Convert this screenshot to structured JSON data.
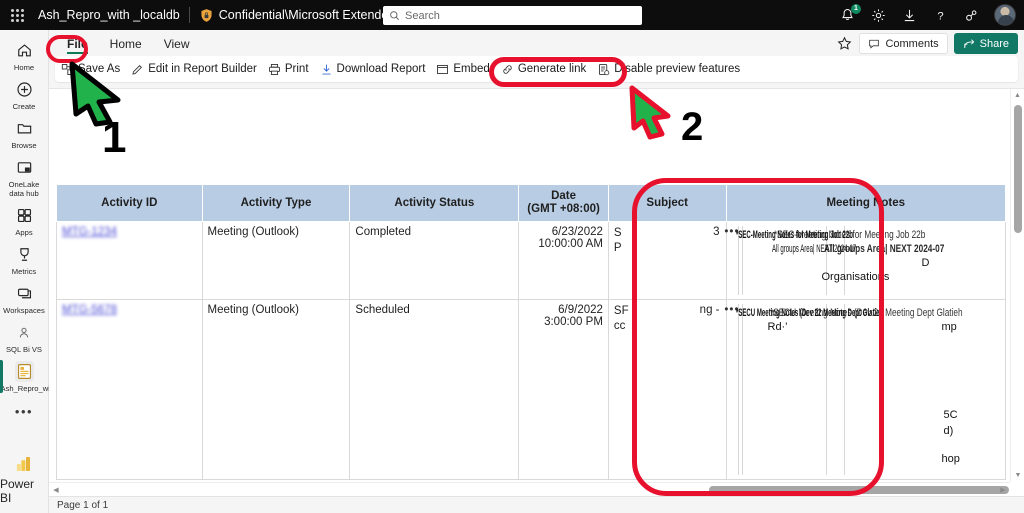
{
  "topbar": {
    "waffle_label": "app-launcher",
    "app_name": "Ash_Repro_with _localdb",
    "sensitivity_label": "Confidential\\Microsoft Extended",
    "sensitivity_chevron": "⌄",
    "search_placeholder": "Search",
    "notification_badge": "1",
    "icons": [
      "bell-icon",
      "gear-icon",
      "download-icon",
      "help-icon",
      "feedback-icon",
      "avatar"
    ]
  },
  "leftnav": {
    "items": [
      {
        "label": "Home",
        "icon": "home-icon"
      },
      {
        "label": "Create",
        "icon": "plus-circle-icon"
      },
      {
        "label": "Browse",
        "icon": "folder-icon"
      },
      {
        "label": "OneLake data hub",
        "icon": "datahub-icon"
      },
      {
        "label": "Apps",
        "icon": "apps-grid-icon"
      },
      {
        "label": "Metrics",
        "icon": "trophy-icon"
      },
      {
        "label": "Workspaces",
        "icon": "workspaces-icon"
      },
      {
        "label": "SQL Bi VS",
        "icon": "workspace-avatar-icon"
      },
      {
        "label": "Ash_Repro_with...",
        "icon": "report-icon"
      }
    ],
    "more": "•••",
    "footer_label": "Power BI"
  },
  "ribbon": {
    "tabs": [
      {
        "label": "File",
        "active": true
      },
      {
        "label": "Home",
        "active": false
      },
      {
        "label": "View",
        "active": false
      }
    ],
    "commands": [
      {
        "label": "Save As",
        "icon": "save-as-icon"
      },
      {
        "label": "Edit in Report Builder",
        "icon": "pencil-icon"
      },
      {
        "label": "Print",
        "icon": "printer-icon"
      },
      {
        "label": "Download Report",
        "icon": "download-arrow-icon"
      },
      {
        "label": "Embed",
        "icon": "embed-icon"
      },
      {
        "label": "Generate link",
        "icon": "link-icon"
      },
      {
        "label": "Disable preview features",
        "icon": "preview-features-icon"
      }
    ],
    "favorite_icon": "star-icon",
    "comments_label": "Comments",
    "share_label": "Share"
  },
  "report": {
    "columns": [
      "Activity ID",
      "Activity Type",
      "Activity Status",
      "Date\n(GMT +08:00)",
      "Subject",
      "Meeting Notes"
    ],
    "date_header_line1": "Date",
    "date_header_line2": "(GMT +08:00)",
    "rows": [
      {
        "activity_id": "MTG-1234",
        "activity_type": "Meeting (Outlook)",
        "activity_status": "Completed",
        "date_line1": "6/23/2022",
        "date_line2": "10:00:00 AM",
        "subject_left_line1": "S",
        "subject_left_line2": "P",
        "subject_right": "3",
        "ellipsis": "•••",
        "notes_fragments": [
          "*SEC-Meeting Notes for Meeting Job 22b",
          "All groups Area| NEXT 2024-07",
          "Organisations",
          "D"
        ]
      },
      {
        "activity_id": "MTG-5678",
        "activity_type": "Meeting (Outlook)",
        "activity_status": "Scheduled",
        "date_line1": "6/9/2022",
        "date_line2": "3:00:00 PM",
        "subject_left_line1": "SF",
        "subject_left_line2": "cc",
        "subject_right": "ng -",
        "ellipsis": "•••",
        "notes_fragments": [
          "*SECU Meeting Notes (Dev 22 Meeting Dept Glatieh",
          "Rd·'",
          "mp",
          "5C",
          "d)",
          "hop"
        ]
      }
    ],
    "status_text": "Page 1 of 1",
    "scroll_left_arrow": "◀",
    "scroll_right_arrow": "▶",
    "scroll_up_arrow": "▲",
    "scroll_down_arrow": "▼"
  },
  "annotations": {
    "markers": [
      {
        "number": "1",
        "target": "File tab"
      },
      {
        "number": "2",
        "target": "Disable preview features"
      }
    ],
    "highlight_color": "#e8112d",
    "arrow_fill": "#21b24b"
  }
}
